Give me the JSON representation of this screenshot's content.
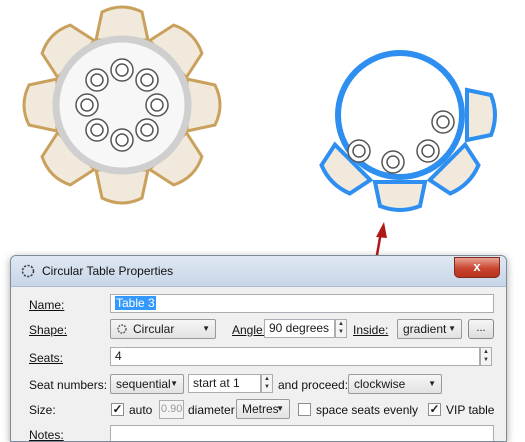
{
  "dialog": {
    "title": "Circular Table Properties",
    "close_glyph": "x",
    "name": {
      "label": "Name:",
      "value": "Table 3"
    },
    "shape": {
      "label": "Shape:",
      "value": "Circular",
      "icon": "circle-shape-icon"
    },
    "angle": {
      "label": "Angle:",
      "value": "90 degrees"
    },
    "inside": {
      "label": "Inside:",
      "value": "gradient"
    },
    "more_button": "...",
    "seats": {
      "label": "Seats:",
      "value": "4"
    },
    "seat_numbers": {
      "label": "Seat numbers:",
      "mode": "sequential",
      "start": "start at 1",
      "proceed_label": "and proceed:",
      "direction": "clockwise"
    },
    "size": {
      "label": "Size:",
      "auto_label": "auto",
      "auto_checked": true,
      "diameter_value": "0.90",
      "diameter_label": "diameter",
      "unit": "Metres",
      "space_label": "space seats evenly",
      "space_checked": false,
      "vip_label": "VIP table",
      "vip_checked": true
    },
    "notes": {
      "label": "Notes:"
    }
  },
  "colors": {
    "seat_gold": "#c9a15d",
    "seat_fill": "#f1e9dc",
    "selection_blue": "#2e8ff0",
    "arrow_red": "#b01818",
    "highlight_oval": "#c0463a",
    "table_gray": "#cfcfcf"
  }
}
